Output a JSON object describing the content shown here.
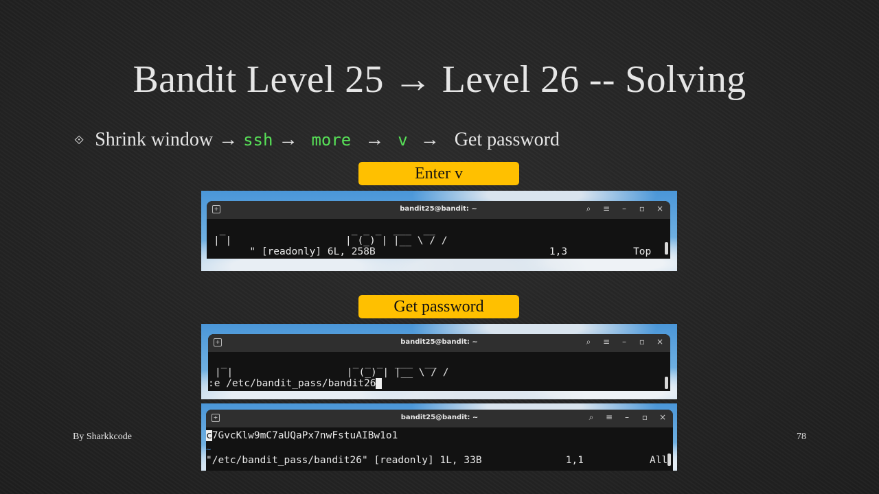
{
  "slide": {
    "title": "Bandit Level 25 → Level 26 -- Solving",
    "bullet": {
      "icon": "diamond-bullet-icon",
      "step1": "Shrink window",
      "step2": "ssh",
      "step3": "more",
      "step4": "v",
      "step5": "Get password",
      "arrow": "→"
    },
    "label1": "Enter v",
    "label2": "Get password",
    "author": "By Sharkkcode",
    "page_number": "78",
    "colors": {
      "label_bg": "#ffc000",
      "code_green": "#57e057"
    }
  },
  "terminals": [
    {
      "title": "bandit25@bandit: ~",
      "lines": [
        " _                     _ _ _  ___  __",
        "| |                   | (_) | |__ \\ / /"
      ],
      "status": "      \" [readonly] 6L, 258B                             1,3           Top"
    },
    {
      "title": "bandit25@bandit: ~",
      "lines": [
        " _                     _ _ _  ___  __",
        "| |                   | (_) | |__ \\ / /"
      ],
      "command": ":e /etc/bandit_pass/bandit26"
    },
    {
      "title": "bandit25@bandit: ~",
      "password_first": "c",
      "password_rest": "7GvcKlw9mC7aUQaPx7nwFstuAIBw1o1",
      "tilde": "~",
      "status": "\"/etc/bandit_pass/bandit26\" [readonly] 1L, 33B              1,1           All"
    }
  ]
}
